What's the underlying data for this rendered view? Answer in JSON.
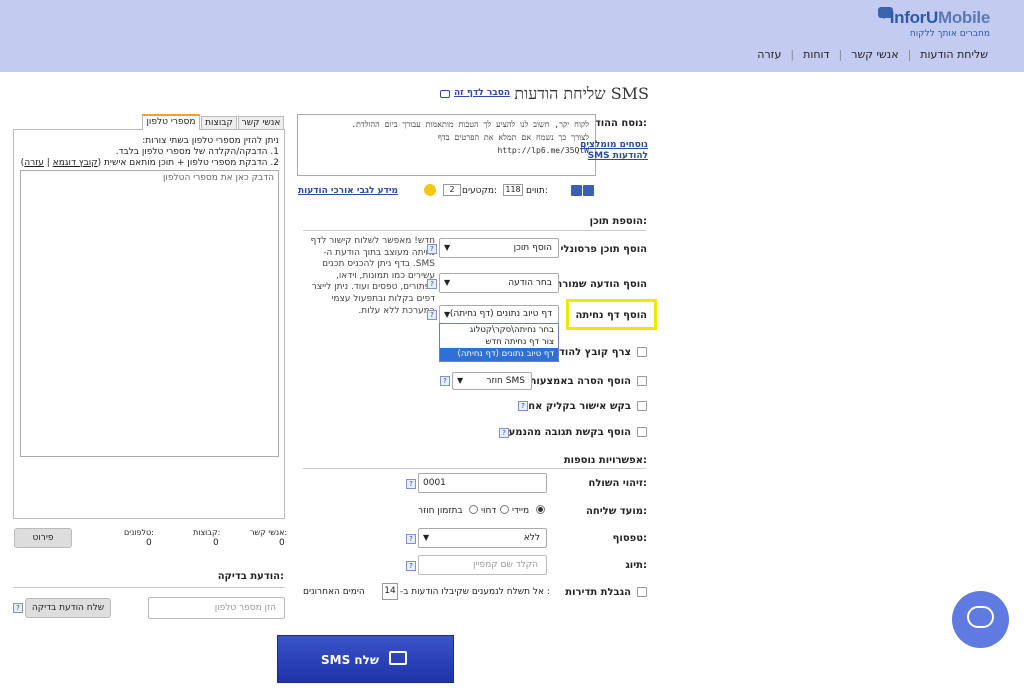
{
  "header": {
    "logo_text_a": "InforU",
    "logo_text_b": "Mobile",
    "tagline": "מחברים אותך ללקוח",
    "nav": [
      "שליחת הודעות",
      "אנשי קשר",
      "דוחות",
      "עזרה"
    ]
  },
  "page": {
    "title": "שליחת הודעות SMS",
    "help_link": "הסבר לדף זה"
  },
  "message": {
    "label": "נוסח ההודעה:",
    "text_line1": "לקוח יקר, חשוב לנו להציע לך הטבות מותאמות עבורך ביום ההולדת.",
    "text_line2": "לצורך כך נשמח אם תמלא את הפרטים בדף",
    "text_line3": "http://lp6.me/35QtW",
    "saved_texts_link": "נוסחים מומלצים להודעות SMS",
    "chars_label": "תווים:",
    "chars_value": "118",
    "segments_label": "מקטעים:",
    "segments_value": "2",
    "long_msgs_link": "מידע לגבי אורכי הודעות"
  },
  "content": {
    "section_title": "הוספת תוכן:",
    "personal_label": "הוסף תוכן פרסונלי",
    "personal_select": "הוסף תוכן",
    "saved_label": "הוסף הודעה שמורה",
    "saved_select": "בחר הודעה",
    "landing_label": "הוסף דף נחיתה",
    "landing_select": "דף טיוב נתונים (דף נחיתה)",
    "landing_options": [
      "בחר נחיתה\\סקר\\קטלוג",
      "צור דף נחיתה חדש",
      "דף טיוב נתונים (דף נחיתה)"
    ],
    "attach_label": "צרף קובץ להודעה",
    "unsubscribe_label": "הוסף הסרה באמצעות",
    "unsubscribe_select": "SMS חוזר",
    "one_click_label": "בקש אישור בקליק אחד",
    "reply_label": "הוסף בקשת תגובה מהנמען",
    "info_text": "חדש! מאפשר לשלוח קישור לדף נחיתה מעוצב בתוך הודעת ה- SMS. בדף ניתן להכניס תכנים עשירים כמו תמונות, וידאו, כפתורים, טפסים ועוד. ניתן לייצר דפים בקלות ובתפעול עצמי במערכת ללא עלות."
  },
  "options": {
    "section_title": "אפשרויות נוספות:",
    "sender_label": "זיהוי השולח:",
    "sender_value": "0001",
    "timing_label": "מועד שליחה:",
    "timing_options": [
      "מיידי",
      "דחוי",
      "בתזמון חוזר"
    ],
    "template_label": "טפסוף:",
    "template_select": "ללא",
    "tag_label": "תיוג:",
    "tag_placeholder": "הקלד שם קמפיין",
    "freq_label": "הגבלת תדירות",
    "freq_text_a": ": אל תשלח לנמענים שקיבלו הודעות ב-",
    "freq_value": "14",
    "freq_text_b": "הימים האחרונים"
  },
  "recipients": {
    "tabs": [
      "מספרי טלפון",
      "קבוצות",
      "אנשי קשר"
    ],
    "intro": "ניתן להזין מספרי טלפון בשתי צורות:",
    "line1": "1. הדבקה/הקלדה של מספרי טלפון בלבד.",
    "line2": "2. הדבקת מספרי טלפון + תוכן מותאם אישית",
    "example_link": "קובץ דוגמא",
    "help_link": "עזרה",
    "placeholder": "הדבק כאן את מספרי הטלפון",
    "contacts_label": "אנשי קשר:",
    "contacts_value": "0",
    "groups_label": "קבוצות:",
    "groups_value": "0",
    "phones_label": "טלפונים:",
    "phones_value": "0",
    "details_button": "פירוט"
  },
  "test": {
    "title": "הודעת בדיקה:",
    "placeholder": "הזן מספר טלפון",
    "button": "שלח הודעת בדיקה"
  },
  "send_button": "שלח SMS"
}
